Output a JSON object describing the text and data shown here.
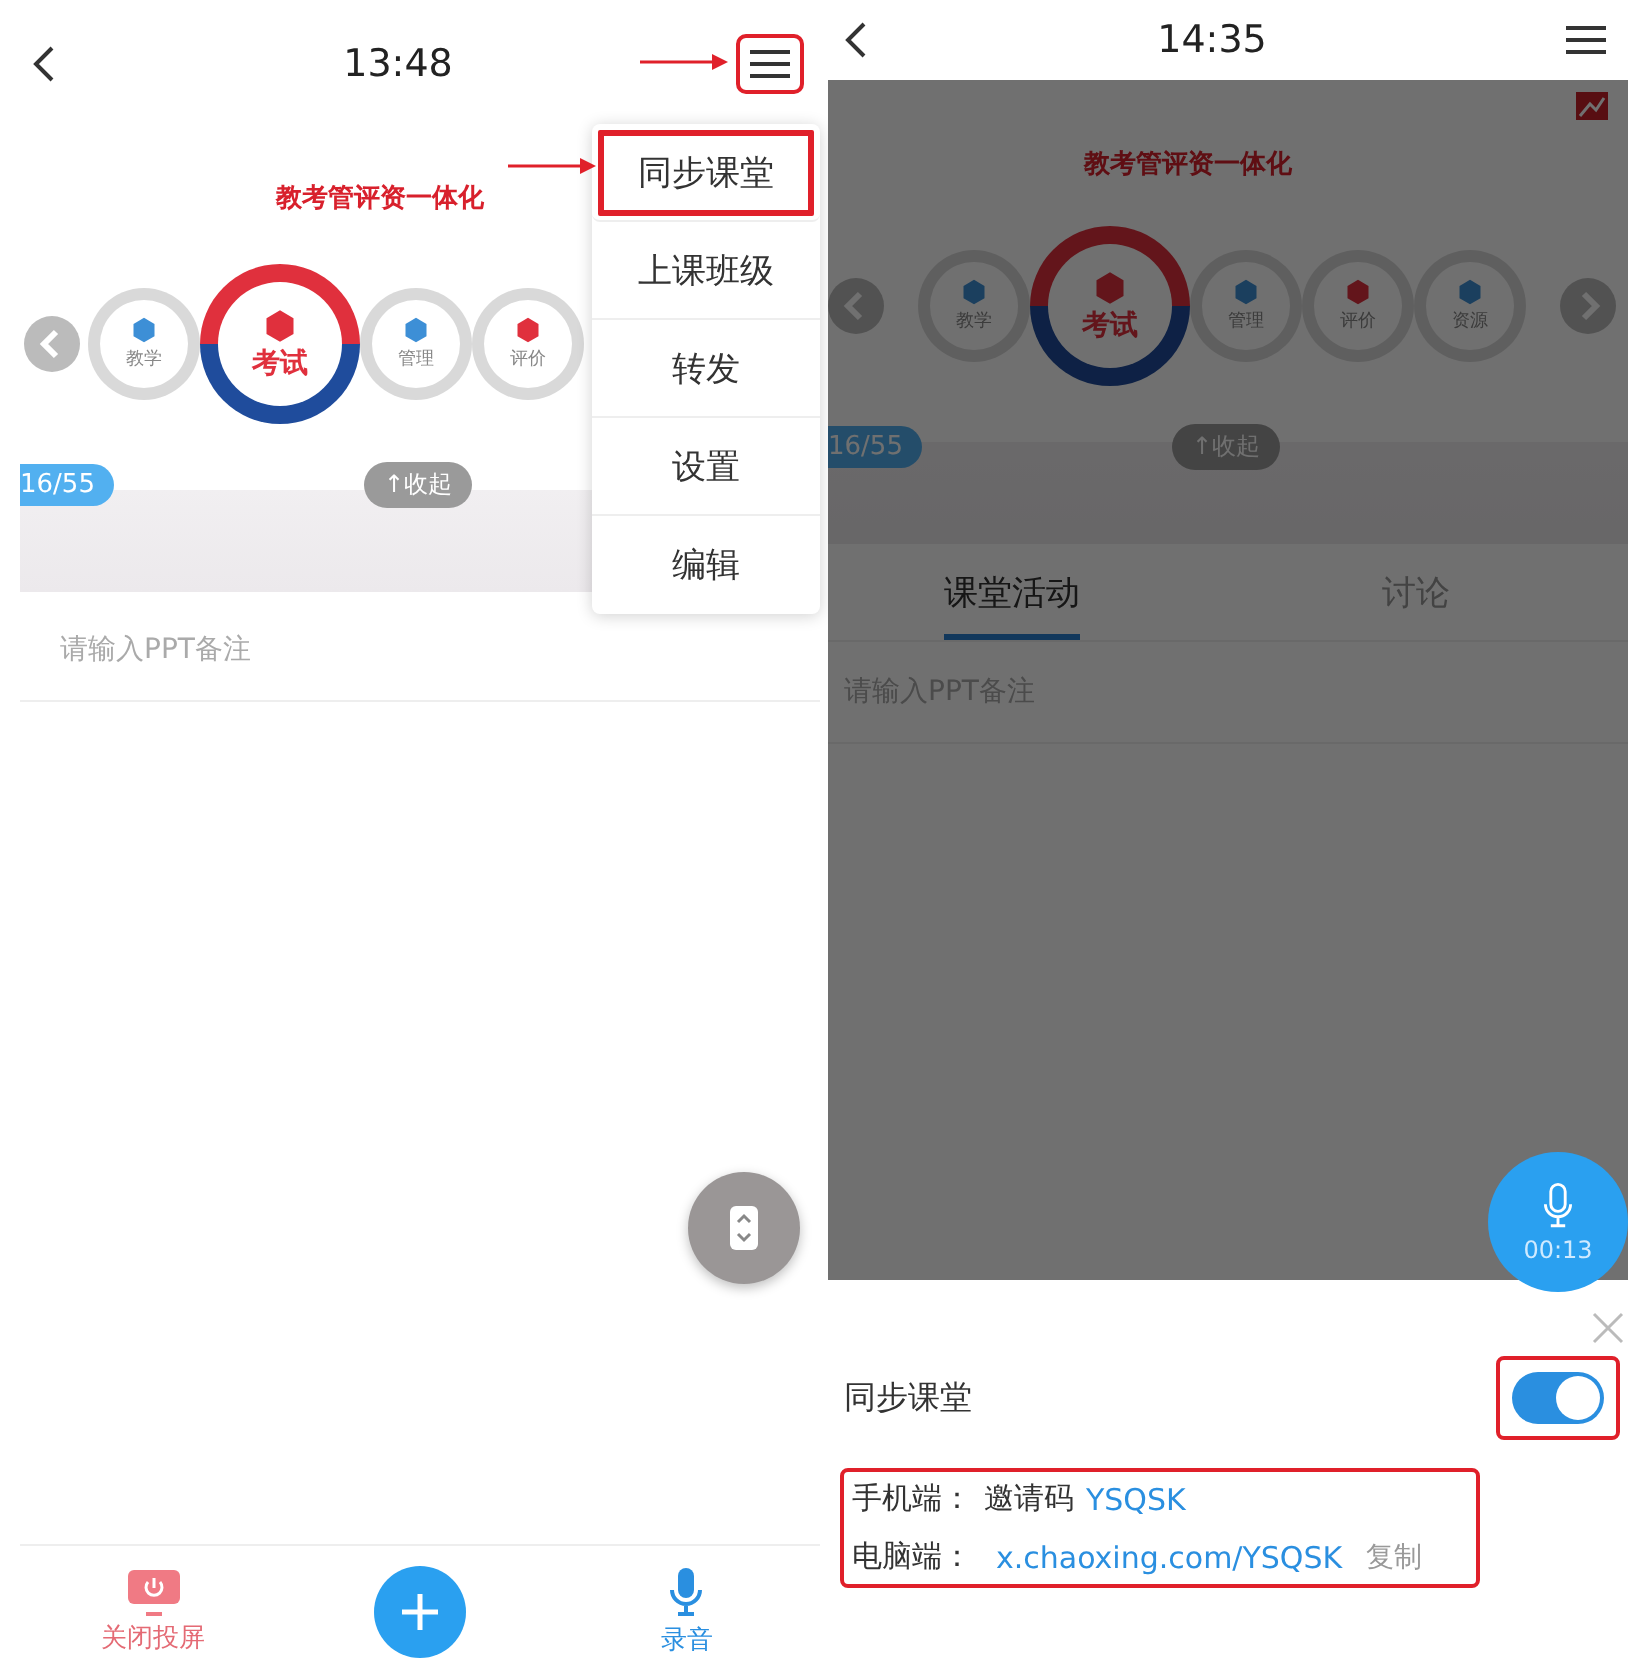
{
  "left": {
    "time": "13:48",
    "menu_button": {
      "highlighted": true
    },
    "banner": "教考管评资一体化",
    "carousel": [
      {
        "label": "教学",
        "selected": false
      },
      {
        "label": "考试",
        "selected": true
      },
      {
        "label": "管理",
        "selected": false
      },
      {
        "label": "评价",
        "selected": false
      }
    ],
    "page": "16/55",
    "collapse": "↑收起",
    "notes_placeholder": "请输入PPT备注",
    "menu": [
      {
        "label": "同步课堂",
        "highlighted": true
      },
      {
        "label": "上课班级",
        "highlighted": false
      },
      {
        "label": "转发",
        "highlighted": false
      },
      {
        "label": "设置",
        "highlighted": false
      },
      {
        "label": "编辑",
        "highlighted": false
      }
    ],
    "bottom_bar": [
      {
        "kind": "screen",
        "label": "关闭投屏"
      },
      {
        "kind": "add"
      },
      {
        "kind": "mic",
        "label": "录音"
      }
    ]
  },
  "right": {
    "time": "14:35",
    "banner": "教考管评资一体化",
    "carousel": [
      {
        "label": "教学",
        "selected": false
      },
      {
        "label": "考试",
        "selected": true
      },
      {
        "label": "管理",
        "selected": false
      },
      {
        "label": "评价",
        "selected": false
      },
      {
        "label": "资源",
        "selected": false
      }
    ],
    "page": "16/55",
    "collapse": "↑收起",
    "tabs": [
      {
        "label": "课堂活动",
        "selected": true
      },
      {
        "label": "讨论",
        "selected": false
      }
    ],
    "notes_placeholder": "请输入PPT备注",
    "record_time": "00:13",
    "sheet": {
      "title": "同步课堂",
      "toggle": {
        "on": true,
        "highlighted": true
      },
      "info": {
        "highlighted": true,
        "phone_label": "手机端：",
        "phone_text": "邀请码",
        "phone_code": "YSQSK",
        "pc_label": "电脑端：",
        "pc_link": "x.chaoxing.com/YSQSK",
        "copy": "复制"
      }
    }
  }
}
